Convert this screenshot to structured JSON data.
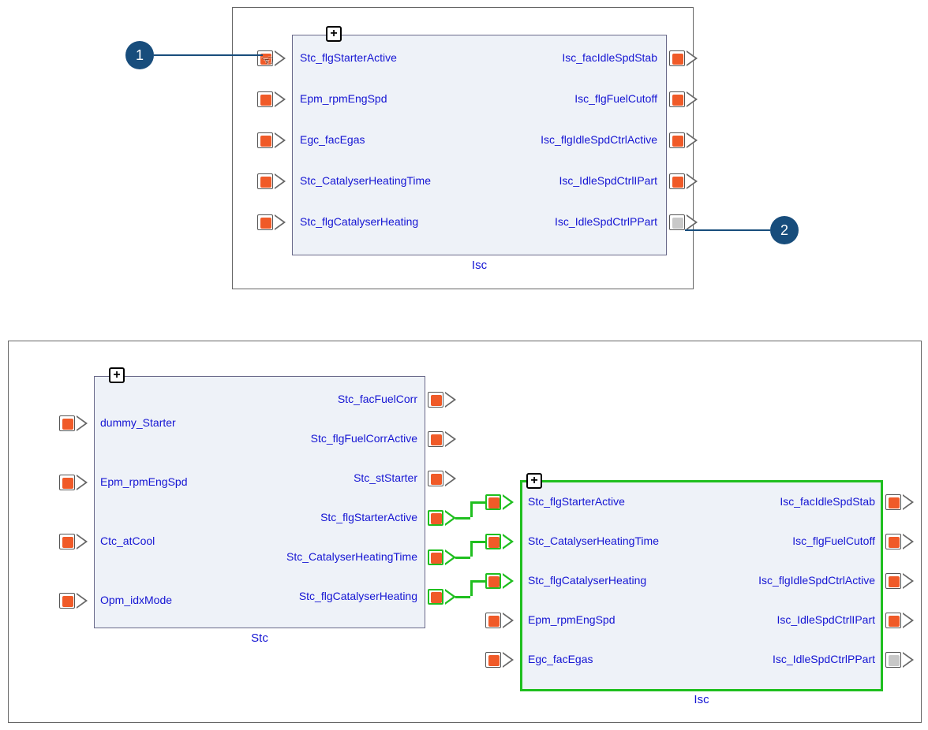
{
  "colors": {
    "accent": "#184d7c",
    "orange": "#f05a28",
    "green": "#1fbf1f",
    "blue": "#1515d3"
  },
  "callouts": [
    "1",
    "2"
  ],
  "panel1": {
    "block": {
      "title": "Isc",
      "inputs": [
        {
          "label": "Stc_flgStarterActive",
          "color": "orange"
        },
        {
          "label": "Epm_rpmEngSpd",
          "color": "orange"
        },
        {
          "label": "Egc_facEgas",
          "color": "orange"
        },
        {
          "label": "Stc_CatalyserHeatingTime",
          "color": "orange"
        },
        {
          "label": "Stc_flgCatalyserHeating",
          "color": "orange"
        }
      ],
      "outputs": [
        {
          "label": "Isc_facIdleSpdStab",
          "color": "orange"
        },
        {
          "label": "Isc_flgFuelCutoff",
          "color": "orange"
        },
        {
          "label": "Isc_flgIdleSpdCtrlActive",
          "color": "orange"
        },
        {
          "label": "Isc_IdleSpdCtrlIPart",
          "color": "orange"
        },
        {
          "label": "Isc_IdleSpdCtrlPPart",
          "color": "grey"
        }
      ]
    }
  },
  "panel2": {
    "stc": {
      "title": "Stc",
      "inputs": [
        {
          "label": "dummy_Starter",
          "color": "orange"
        },
        {
          "label": "Epm_rpmEngSpd",
          "color": "orange"
        },
        {
          "label": "Ctc_atCool",
          "color": "orange"
        },
        {
          "label": "Opm_idxMode",
          "color": "orange"
        }
      ],
      "outputs": [
        {
          "label": "Stc_facFuelCorr",
          "color": "orange",
          "connected": false
        },
        {
          "label": "Stc_flgFuelCorrActive",
          "color": "orange",
          "connected": false
        },
        {
          "label": "Stc_stStarter",
          "color": "orange",
          "connected": false
        },
        {
          "label": "Stc_flgStarterActive",
          "color": "orange",
          "connected": true
        },
        {
          "label": "Stc_CatalyserHeatingTime",
          "color": "orange",
          "connected": true
        },
        {
          "label": "Stc_flgCatalyserHeating",
          "color": "orange",
          "connected": true
        }
      ]
    },
    "isc": {
      "title": "Isc",
      "inputs": [
        {
          "label": "Stc_flgStarterActive",
          "color": "orange",
          "green": true
        },
        {
          "label": "Stc_CatalyserHeatingTime",
          "color": "orange",
          "green": true
        },
        {
          "label": "Stc_flgCatalyserHeating",
          "color": "orange",
          "green": true
        },
        {
          "label": "Epm_rpmEngSpd",
          "color": "orange",
          "green": false
        },
        {
          "label": "Egc_facEgas",
          "color": "orange",
          "green": false
        }
      ],
      "outputs": [
        {
          "label": "Isc_facIdleSpdStab",
          "color": "orange"
        },
        {
          "label": "Isc_flgFuelCutoff",
          "color": "orange"
        },
        {
          "label": "Isc_flgIdleSpdCtrlActive",
          "color": "orange"
        },
        {
          "label": "Isc_IdleSpdCtrlIPart",
          "color": "orange"
        },
        {
          "label": "Isc_IdleSpdCtrlPPart",
          "color": "grey"
        }
      ]
    }
  }
}
